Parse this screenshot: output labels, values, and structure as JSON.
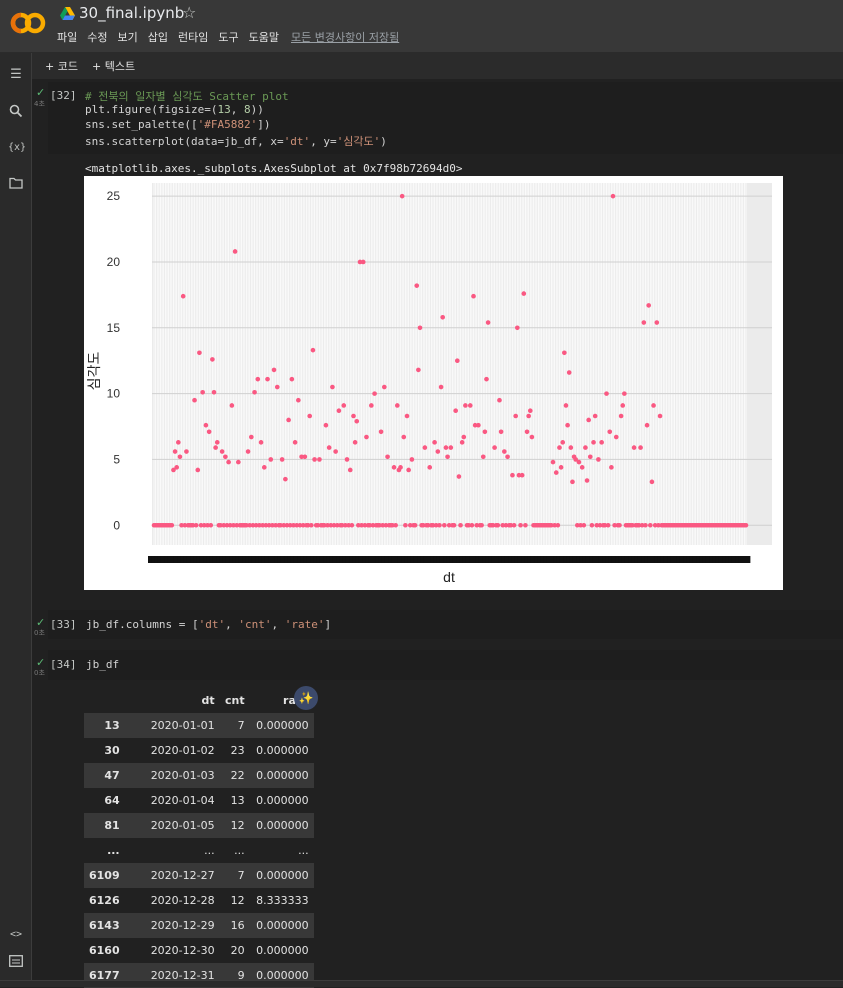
{
  "app": {
    "notebook_title": "30_final.ipynb",
    "menu": [
      "파일",
      "수정",
      "보기",
      "삽입",
      "런타임",
      "도구",
      "도움말"
    ],
    "save_status": "모든 변경사항이 저장됨"
  },
  "toolbar": {
    "add_code": "+ 코드",
    "add_text": "+ 텍스트"
  },
  "cells": [
    {
      "prompt": "[32]",
      "time": "4초",
      "lines": [
        "# 전북의 일자별 심각도 Scatter plot",
        "plt.figure(figsize=(13, 8))",
        "sns.set_palette(['#FA5882'])",
        "sns.scatterplot(data=jb_df, x='dt', y='심각도')"
      ],
      "output_text": "<matplotlib.axes._subplots.AxesSubplot at 0x7f98b72694d0>"
    },
    {
      "prompt": "[33]",
      "time": "0초",
      "code": "jb_df.columns = ['dt', 'cnt', 'rate']"
    },
    {
      "prompt": "[34]",
      "time": "0초",
      "code": "jb_df"
    }
  ],
  "chart_data": {
    "type": "scatter",
    "xlabel": "dt",
    "ylabel": "심각도",
    "ylim": [
      -1.5,
      26
    ],
    "yticks": [
      0,
      5,
      10,
      15,
      20,
      25
    ],
    "n_points": 366,
    "color": "#FA5882",
    "grid": true,
    "nonzero_points": [
      [
        12,
        4.2
      ],
      [
        13,
        5.6
      ],
      [
        14,
        4.4
      ],
      [
        15,
        6.3
      ],
      [
        16,
        5.2
      ],
      [
        18,
        17.4
      ],
      [
        20,
        5.6
      ],
      [
        25,
        9.5
      ],
      [
        27,
        4.2
      ],
      [
        28,
        13.1
      ],
      [
        30,
        10.1
      ],
      [
        32,
        7.6
      ],
      [
        34,
        7.1
      ],
      [
        36,
        12.6
      ],
      [
        37,
        10.1
      ],
      [
        38,
        5.9
      ],
      [
        39,
        6.3
      ],
      [
        42,
        5.6
      ],
      [
        44,
        5.2
      ],
      [
        46,
        4.8
      ],
      [
        48,
        9.1
      ],
      [
        50,
        20.8
      ],
      [
        52,
        4.8
      ],
      [
        58,
        5.6
      ],
      [
        60,
        6.7
      ],
      [
        62,
        10.1
      ],
      [
        64,
        11.1
      ],
      [
        66,
        6.3
      ],
      [
        68,
        4.4
      ],
      [
        70,
        11.1
      ],
      [
        72,
        5.0
      ],
      [
        74,
        11.8
      ],
      [
        76,
        10.5
      ],
      [
        79,
        5.0
      ],
      [
        81,
        3.5
      ],
      [
        83,
        8.0
      ],
      [
        85,
        11.1
      ],
      [
        87,
        6.3
      ],
      [
        89,
        9.5
      ],
      [
        91,
        5.2
      ],
      [
        93,
        5.2
      ],
      [
        96,
        8.3
      ],
      [
        98,
        13.3
      ],
      [
        99,
        5.0
      ],
      [
        102,
        5.0
      ],
      [
        106,
        7.6
      ],
      [
        108,
        5.9
      ],
      [
        110,
        10.5
      ],
      [
        112,
        5.6
      ],
      [
        114,
        8.7
      ],
      [
        117,
        9.1
      ],
      [
        119,
        5.0
      ],
      [
        121,
        4.2
      ],
      [
        123,
        8.3
      ],
      [
        124,
        6.3
      ],
      [
        125,
        7.9
      ],
      [
        127,
        20.0
      ],
      [
        129,
        20.0
      ],
      [
        131,
        6.7
      ],
      [
        134,
        9.1
      ],
      [
        136,
        10.0
      ],
      [
        140,
        7.1
      ],
      [
        142,
        10.5
      ],
      [
        144,
        5.2
      ],
      [
        148,
        4.4
      ],
      [
        150,
        9.1
      ],
      [
        151,
        4.2
      ],
      [
        152,
        4.4
      ],
      [
        153,
        25.0
      ],
      [
        154,
        6.7
      ],
      [
        156,
        8.3
      ],
      [
        157,
        4.2
      ],
      [
        159,
        5.0
      ],
      [
        162,
        18.2
      ],
      [
        163,
        11.8
      ],
      [
        164,
        15.0
      ],
      [
        167,
        5.9
      ],
      [
        170,
        4.4
      ],
      [
        173,
        6.3
      ],
      [
        175,
        5.6
      ],
      [
        177,
        10.5
      ],
      [
        178,
        15.8
      ],
      [
        180,
        5.9
      ],
      [
        181,
        5.2
      ],
      [
        183,
        5.9
      ],
      [
        186,
        8.7
      ],
      [
        187,
        12.5
      ],
      [
        188,
        3.7
      ],
      [
        190,
        6.3
      ],
      [
        191,
        6.7
      ],
      [
        192,
        9.1
      ],
      [
        195,
        9.1
      ],
      [
        197,
        17.4
      ],
      [
        198,
        7.6
      ],
      [
        200,
        7.6
      ],
      [
        203,
        5.2
      ],
      [
        204,
        7.1
      ],
      [
        205,
        11.1
      ],
      [
        206,
        15.4
      ],
      [
        210,
        5.9
      ],
      [
        213,
        9.5
      ],
      [
        214,
        7.1
      ],
      [
        216,
        5.6
      ],
      [
        218,
        5.2
      ],
      [
        221,
        3.8
      ],
      [
        223,
        8.3
      ],
      [
        224,
        15.0
      ],
      [
        225,
        3.8
      ],
      [
        227,
        3.8
      ],
      [
        228,
        17.6
      ],
      [
        230,
        7.1
      ],
      [
        231,
        8.3
      ],
      [
        232,
        8.7
      ],
      [
        233,
        6.7
      ],
      [
        246,
        4.8
      ],
      [
        248,
        4.0
      ],
      [
        250,
        5.9
      ],
      [
        251,
        4.4
      ],
      [
        252,
        6.3
      ],
      [
        253,
        13.1
      ],
      [
        254,
        9.1
      ],
      [
        255,
        7.6
      ],
      [
        256,
        11.6
      ],
      [
        257,
        5.9
      ],
      [
        258,
        3.3
      ],
      [
        259,
        5.2
      ],
      [
        260,
        5.0
      ],
      [
        262,
        4.8
      ],
      [
        264,
        4.4
      ],
      [
        266,
        5.9
      ],
      [
        267,
        3.4
      ],
      [
        268,
        8.0
      ],
      [
        269,
        5.2
      ],
      [
        271,
        6.3
      ],
      [
        272,
        8.3
      ],
      [
        274,
        5.0
      ],
      [
        276,
        6.3
      ],
      [
        279,
        10.0
      ],
      [
        281,
        7.1
      ],
      [
        282,
        4.4
      ],
      [
        283,
        25.0
      ],
      [
        285,
        6.7
      ],
      [
        288,
        8.3
      ],
      [
        289,
        9.1
      ],
      [
        290,
        10.0
      ],
      [
        296,
        5.9
      ],
      [
        300,
        5.9
      ],
      [
        302,
        15.4
      ],
      [
        304,
        7.6
      ],
      [
        305,
        16.7
      ],
      [
        307,
        3.3
      ],
      [
        308,
        9.1
      ],
      [
        310,
        15.4
      ],
      [
        312,
        8.3
      ]
    ]
  },
  "dataframe": {
    "columns": [
      "dt",
      "cnt",
      "rate"
    ],
    "rows": [
      [
        "13",
        "2020-01-01",
        "7",
        "0.000000"
      ],
      [
        "30",
        "2020-01-02",
        "23",
        "0.000000"
      ],
      [
        "47",
        "2020-01-03",
        "22",
        "0.000000"
      ],
      [
        "64",
        "2020-01-04",
        "13",
        "0.000000"
      ],
      [
        "81",
        "2020-01-05",
        "12",
        "0.000000"
      ],
      [
        "...",
        "...",
        "...",
        "..."
      ],
      [
        "6109",
        "2020-12-27",
        "7",
        "0.000000"
      ],
      [
        "6126",
        "2020-12-28",
        "12",
        "8.333333"
      ],
      [
        "6143",
        "2020-12-29",
        "16",
        "0.000000"
      ],
      [
        "6160",
        "2020-12-30",
        "20",
        "0.000000"
      ],
      [
        "6177",
        "2020-12-31",
        "9",
        "0.000000"
      ]
    ]
  },
  "icons": [
    "colab-logo-icon",
    "drive-icon",
    "star-icon",
    "toc-icon",
    "search-icon",
    "variables-icon",
    "folder-icon",
    "code-snippets-icon",
    "terminal-icon",
    "magic-wand-icon",
    "check-icon"
  ]
}
